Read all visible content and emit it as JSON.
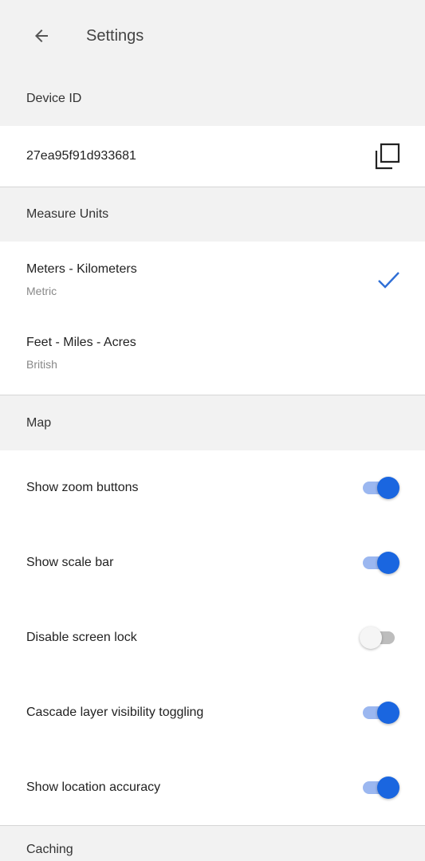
{
  "header": {
    "title": "Settings"
  },
  "device_id": {
    "header": "Device ID",
    "value": "27ea95f91d933681"
  },
  "measure_units": {
    "header": "Measure Units",
    "options": [
      {
        "label": "Meters - Kilometers",
        "sub": "Metric",
        "selected": true
      },
      {
        "label": "Feet - Miles - Acres",
        "sub": "British",
        "selected": false
      }
    ]
  },
  "map": {
    "header": "Map",
    "settings": [
      {
        "label": "Show zoom buttons",
        "on": true
      },
      {
        "label": "Show scale bar",
        "on": true
      },
      {
        "label": "Disable screen lock",
        "on": false
      },
      {
        "label": "Cascade layer visibility toggling",
        "on": true
      },
      {
        "label": "Show location accuracy",
        "on": true
      }
    ]
  },
  "caching": {
    "header": "Caching"
  },
  "icons": {
    "back": "arrow-left-icon",
    "copy": "copy-icon",
    "check": "check-icon"
  },
  "colors": {
    "accent": "#1a66e0",
    "accent_track": "#9bb7f0",
    "background": "#f2f2f2",
    "row_background": "#ffffff",
    "check": "#2f6fd6"
  }
}
